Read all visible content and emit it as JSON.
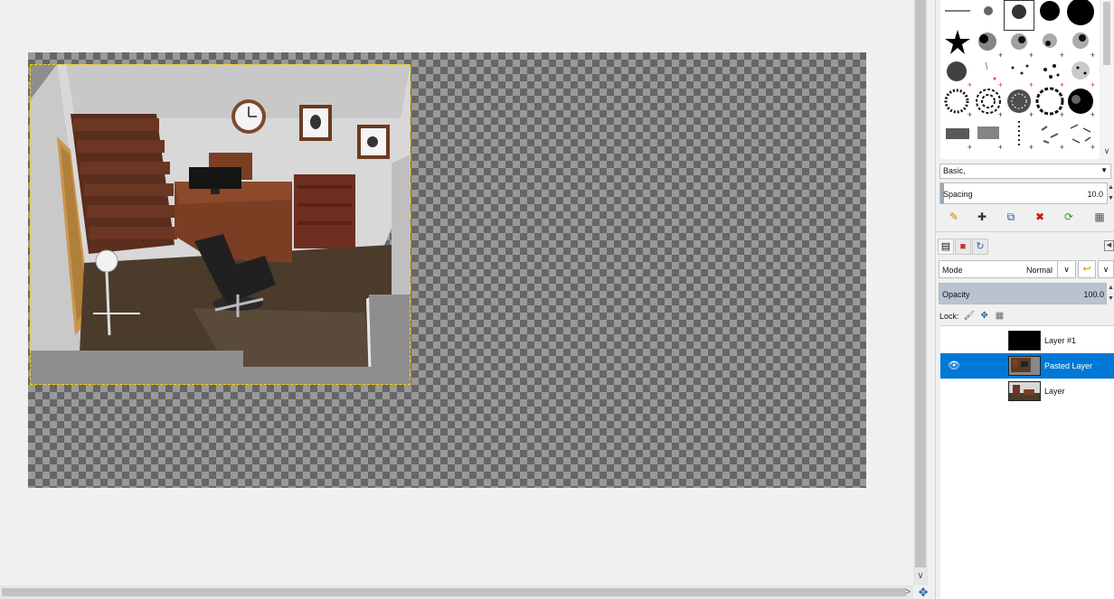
{
  "canvas": {
    "image": "office room interior rendering pasted on transparent canvas"
  },
  "brushes": {
    "tag_filter": "Basic,",
    "spacing_label": "Spacing",
    "spacing_value": "10.0",
    "actions": [
      "edit-brush-icon",
      "new-brush-icon",
      "duplicate-brush-icon",
      "delete-brush-icon",
      "refresh-brushes-icon",
      "open-brush-image-icon"
    ]
  },
  "layers": {
    "mode_label": "Mode",
    "mode_value": "Normal",
    "opacity_label": "Opacity",
    "opacity_value": "100.0",
    "opacity_fraction": 1.0,
    "lock_label": "Lock:",
    "items": [
      {
        "name": "Layer #1",
        "visible": false,
        "selected": false
      },
      {
        "name": "Pasted Layer",
        "visible": true,
        "selected": true
      },
      {
        "name": "Layer",
        "visible": false,
        "selected": false
      }
    ]
  },
  "colors": {
    "selection_accent": "#0078d7",
    "selection_marquee": "#ffd400"
  }
}
